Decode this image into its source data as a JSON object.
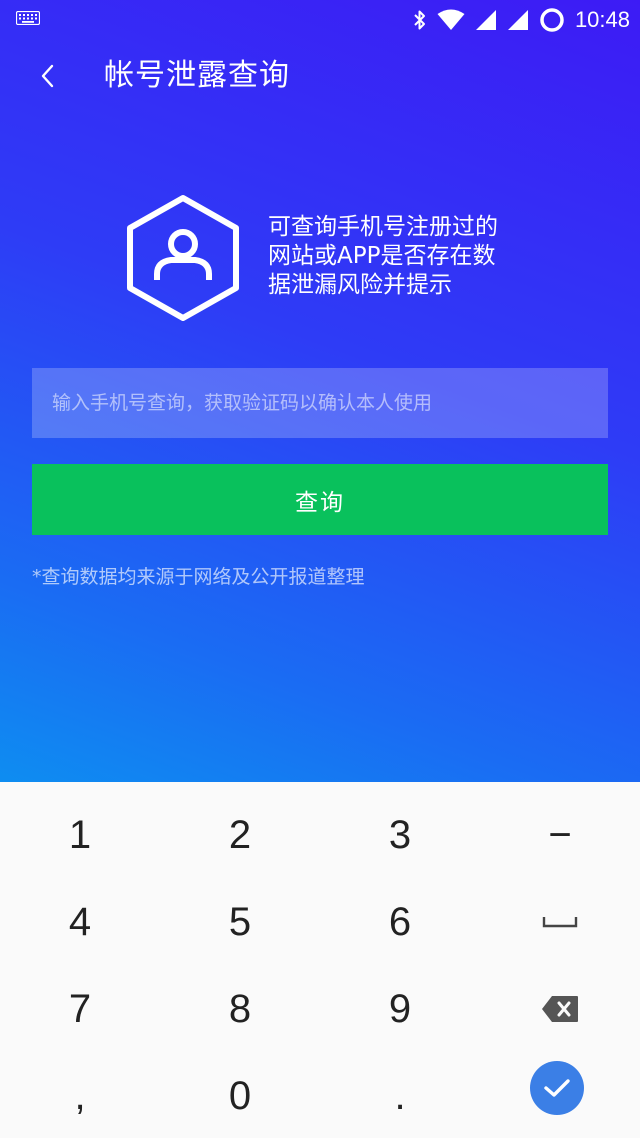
{
  "status_bar": {
    "time": "10:48",
    "icons": [
      "keyboard-indicator-icon",
      "bluetooth-icon",
      "wifi-icon",
      "signal-icon",
      "signal-icon",
      "battery-ring-icon"
    ]
  },
  "header": {
    "title": "帐号泄露查询",
    "back_icon": "chevron-left-icon"
  },
  "info": {
    "icon": "hexagon-user-icon",
    "lines": [
      "可查询手机号注册过的",
      "网站或APP是否存在数",
      "据泄漏风险并提示"
    ]
  },
  "form": {
    "phone_placeholder": "输入手机号查询，获取验证码以确认本人使用",
    "phone_value": "",
    "query_label": "查询",
    "disclaimer": "*查询数据均来源于网络及公开报道整理"
  },
  "colors": {
    "gradient_top": "#3d1bf5",
    "gradient_bottom": "#0e8df1",
    "button_green": "#09c15c",
    "keyboard_bg": "#fafafa",
    "confirm_blue": "#3b7fe6"
  },
  "keyboard": {
    "row1": [
      "1",
      "2",
      "3",
      "−"
    ],
    "row2": [
      "4",
      "5",
      "6"
    ],
    "row3": [
      "7",
      "8",
      "9"
    ],
    "row4": [
      ",",
      "0",
      "."
    ],
    "special_icons": [
      "space-icon",
      "backspace-icon",
      "check-icon"
    ]
  }
}
